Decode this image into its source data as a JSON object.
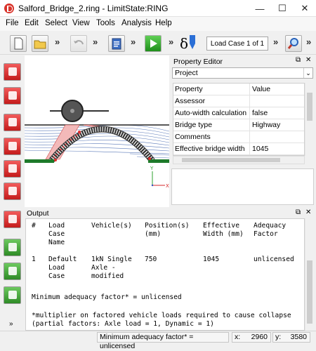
{
  "window": {
    "title": "Salford_Bridge_2.ring - LimitState:RING",
    "minimize": "—",
    "maximize": "☐",
    "close": "✕"
  },
  "menu": {
    "items": [
      "File",
      "Edit",
      "Select",
      "View",
      "Tools",
      "Analysis",
      "Help"
    ]
  },
  "toolbar": {
    "chevron": "»",
    "delta": "δ",
    "load_case": "Load Case 1 of 1"
  },
  "property_editor": {
    "title": "Property Editor",
    "object": "Project",
    "header_property": "Property",
    "header_value": "Value",
    "rows": [
      {
        "property": "Assessor",
        "value": ""
      },
      {
        "property": "Auto-width calculation",
        "value": "false"
      },
      {
        "property": "Bridge type",
        "value": "Highway"
      },
      {
        "property": "Comments",
        "value": ""
      },
      {
        "property": "Effective bridge width",
        "value": "1045"
      }
    ]
  },
  "output": {
    "title": "Output",
    "header_hash": "#",
    "header_load": [
      "Load",
      "Case",
      "Name"
    ],
    "header_vehicle": "Vehicle(s)",
    "header_position": [
      "Position(s)",
      "(mm)"
    ],
    "header_width": [
      "Effective",
      "Width (mm)"
    ],
    "header_adequacy": [
      "Adequacy",
      "Factor"
    ],
    "row_num": "1",
    "row_load": [
      "Default",
      "Load",
      "Case"
    ],
    "row_vehicle": [
      "1kN Single",
      "Axle -",
      "modified"
    ],
    "row_position": "750",
    "row_width": "1045",
    "row_adequacy": "unlicensed",
    "min_factor": "Minimum adequacy factor* = unlicensed",
    "footnote1": "*multiplier on factored vehicle loads required to cause collapse",
    "footnote2": "(partial factors: Axle load = 1, Dynamic = 1)"
  },
  "status": {
    "message": "Minimum adequacy factor* = unlicensed",
    "x_label": "x:",
    "x_value": "2960",
    "y_label": "y:",
    "y_value": "3580"
  },
  "colors": {
    "accent_red": "#d9342b",
    "accent_green": "#3aa32f",
    "grid_blue": "#5a79b8",
    "ground_green": "#1e7a2a"
  }
}
